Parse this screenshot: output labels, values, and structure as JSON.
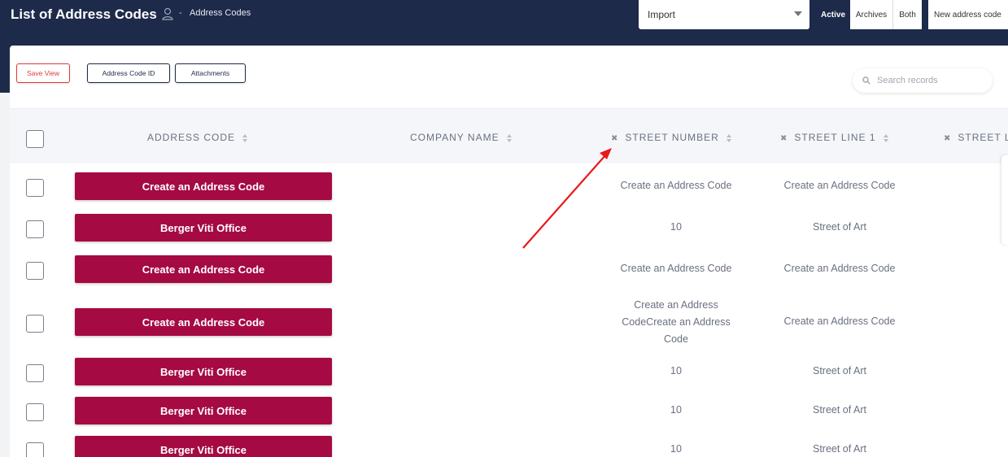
{
  "header": {
    "title": "List of Address Codes",
    "breadcrumb_sep": "-",
    "breadcrumb_label": "Address Codes",
    "import_value": "Import",
    "segments": {
      "active": "Active",
      "archives": "Archives",
      "both": "Both"
    },
    "new_button": "New address code"
  },
  "toolbar": {
    "save_view": "Save View",
    "address_code_id": "Address Code ID",
    "attachments": "Attachments",
    "search_placeholder": "Search records"
  },
  "table": {
    "columns": {
      "address_code": "ADDRESS CODE",
      "company_name": "COMPANY NAME",
      "street_number": "STREET NUMBER",
      "street_line_1": "STREET LINE 1",
      "street_line_2": "STREET LI"
    },
    "rows": [
      {
        "code": "Create an Address Code",
        "street_number": "Create an Address Code",
        "street_line_1": "Create an Address Code"
      },
      {
        "code": "Berger Viti Office",
        "street_number": "10",
        "street_line_1": "Street of Art"
      },
      {
        "code": "Create an Address Code",
        "street_number": "Create an Address Code",
        "street_line_1": "Create an Address Code"
      },
      {
        "code": "Create an Address Code",
        "street_number": "Create an Address CodeCreate an Address Code",
        "street_line_1": "Create an Address Code"
      },
      {
        "code": "Berger Viti Office",
        "street_number": "10",
        "street_line_1": "Street of Art"
      },
      {
        "code": "Berger Viti Office",
        "street_number": "10",
        "street_line_1": "Street of Art"
      },
      {
        "code": "Berger Viti Office",
        "street_number": "10",
        "street_line_1": "Street of Art"
      }
    ]
  },
  "colors": {
    "header_bg": "#1d2a4a",
    "row_button": "#a50a42",
    "save_view": "#e03a3a",
    "annotation_arrow": "#e8191c"
  }
}
